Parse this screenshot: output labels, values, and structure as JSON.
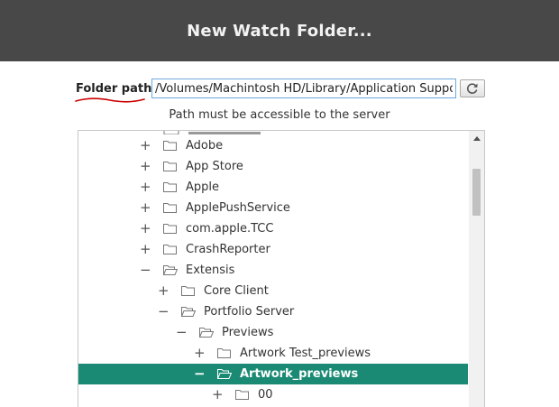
{
  "dialog": {
    "title": "New Watch Folder..."
  },
  "path": {
    "label": "Folder path",
    "value": "/Volumes/Machintosh HD/Library/Application Support",
    "hint": "Path must be accessible to the server"
  },
  "colors": {
    "header": "#484848",
    "selected": "#1a8a74",
    "accent_underline": "#cc0000"
  },
  "tree": {
    "rows": [
      {
        "label": "Adobe",
        "depth": 0,
        "toggle": "+",
        "open": false,
        "selected": false
      },
      {
        "label": "App Store",
        "depth": 0,
        "toggle": "+",
        "open": false,
        "selected": false
      },
      {
        "label": "Apple",
        "depth": 0,
        "toggle": "+",
        "open": false,
        "selected": false
      },
      {
        "label": "ApplePushService",
        "depth": 0,
        "toggle": "+",
        "open": false,
        "selected": false
      },
      {
        "label": "com.apple.TCC",
        "depth": 0,
        "toggle": "+",
        "open": false,
        "selected": false
      },
      {
        "label": "CrashReporter",
        "depth": 0,
        "toggle": "+",
        "open": false,
        "selected": false
      },
      {
        "label": "Extensis",
        "depth": 0,
        "toggle": "−",
        "open": true,
        "selected": false
      },
      {
        "label": "Core Client",
        "depth": 1,
        "toggle": "+",
        "open": false,
        "selected": false
      },
      {
        "label": "Portfolio Server",
        "depth": 1,
        "toggle": "−",
        "open": true,
        "selected": false
      },
      {
        "label": "Previews",
        "depth": 2,
        "toggle": "−",
        "open": true,
        "selected": false
      },
      {
        "label": "Artwork Test_previews",
        "depth": 3,
        "toggle": "+",
        "open": false,
        "selected": false
      },
      {
        "label": "Artwork_previews",
        "depth": 3,
        "toggle": "−",
        "open": true,
        "selected": true
      },
      {
        "label": "00",
        "depth": 4,
        "toggle": "+",
        "open": false,
        "selected": false
      }
    ]
  }
}
